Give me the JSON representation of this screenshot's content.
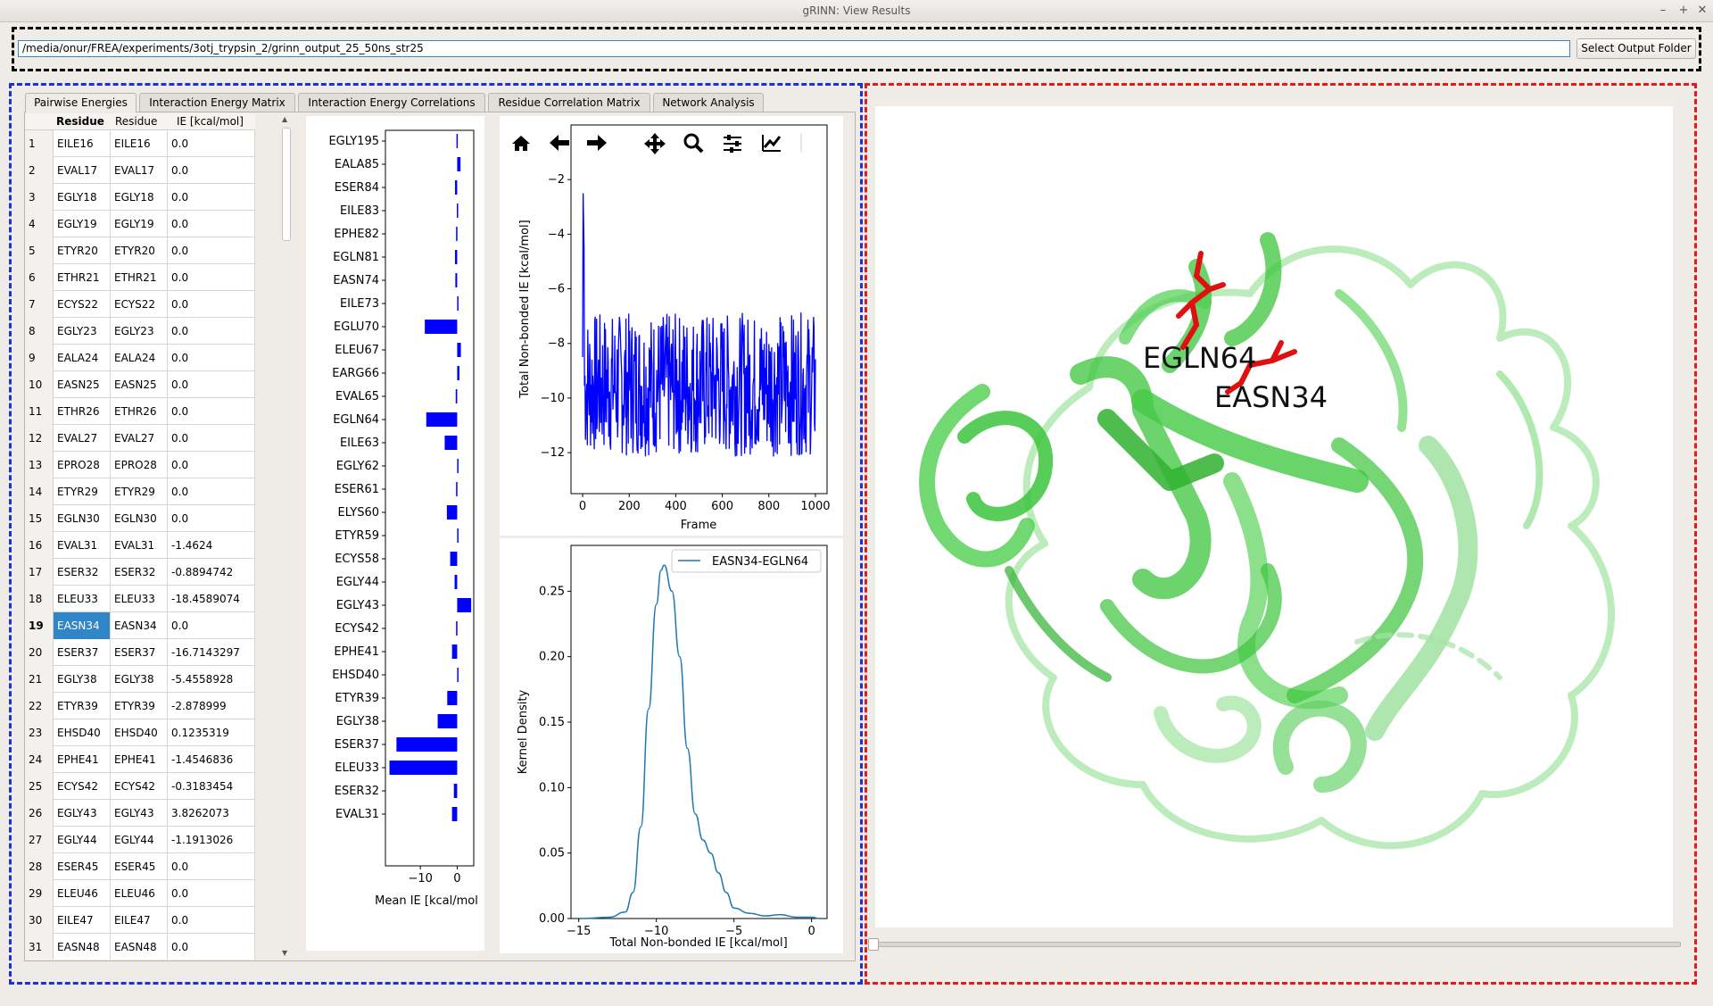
{
  "window": {
    "title": "gRINN: View Results"
  },
  "folder": {
    "path": "/media/onur/FREA/experiments/3otj_trypsin_2/grinn_output_25_50ns_str25",
    "button_label": "Select Output Folder"
  },
  "tabs": [
    {
      "label": "Pairwise Energies"
    },
    {
      "label": "Interaction Energy Matrix"
    },
    {
      "label": "Interaction Energy Correlations"
    },
    {
      "label": "Residue Correlation Matrix"
    },
    {
      "label": "Network Analysis"
    }
  ],
  "table": {
    "headers": [
      "Residue",
      "Residue",
      "IE [kcal/mol]"
    ],
    "selected_row": 19,
    "rows": [
      {
        "n": "1",
        "a": "EILE16",
        "b": "EILE16",
        "ie": "0.0"
      },
      {
        "n": "2",
        "a": "EVAL17",
        "b": "EVAL17",
        "ie": "0.0"
      },
      {
        "n": "3",
        "a": "EGLY18",
        "b": "EGLY18",
        "ie": "0.0"
      },
      {
        "n": "4",
        "a": "EGLY19",
        "b": "EGLY19",
        "ie": "0.0"
      },
      {
        "n": "5",
        "a": "ETYR20",
        "b": "ETYR20",
        "ie": "0.0"
      },
      {
        "n": "6",
        "a": "ETHR21",
        "b": "ETHR21",
        "ie": "0.0"
      },
      {
        "n": "7",
        "a": "ECYS22",
        "b": "ECYS22",
        "ie": "0.0"
      },
      {
        "n": "8",
        "a": "EGLY23",
        "b": "EGLY23",
        "ie": "0.0"
      },
      {
        "n": "9",
        "a": "EALA24",
        "b": "EALA24",
        "ie": "0.0"
      },
      {
        "n": "10",
        "a": "EASN25",
        "b": "EASN25",
        "ie": "0.0"
      },
      {
        "n": "11",
        "a": "ETHR26",
        "b": "ETHR26",
        "ie": "0.0"
      },
      {
        "n": "12",
        "a": "EVAL27",
        "b": "EVAL27",
        "ie": "0.0"
      },
      {
        "n": "13",
        "a": "EPRO28",
        "b": "EPRO28",
        "ie": "0.0"
      },
      {
        "n": "14",
        "a": "ETYR29",
        "b": "ETYR29",
        "ie": "0.0"
      },
      {
        "n": "15",
        "a": "EGLN30",
        "b": "EGLN30",
        "ie": "0.0"
      },
      {
        "n": "16",
        "a": "EVAL31",
        "b": "EVAL31",
        "ie": "-1.4624"
      },
      {
        "n": "17",
        "a": "ESER32",
        "b": "ESER32",
        "ie": "-0.8894742"
      },
      {
        "n": "18",
        "a": "ELEU33",
        "b": "ELEU33",
        "ie": "-18.4589074"
      },
      {
        "n": "19",
        "a": "EASN34",
        "b": "EASN34",
        "ie": "0.0"
      },
      {
        "n": "20",
        "a": "ESER37",
        "b": "ESER37",
        "ie": "-16.7143297"
      },
      {
        "n": "21",
        "a": "EGLY38",
        "b": "EGLY38",
        "ie": "-5.4558928"
      },
      {
        "n": "22",
        "a": "ETYR39",
        "b": "ETYR39",
        "ie": "-2.878999"
      },
      {
        "n": "23",
        "a": "EHSD40",
        "b": "EHSD40",
        "ie": "0.1235319"
      },
      {
        "n": "24",
        "a": "EPHE41",
        "b": "EPHE41",
        "ie": "-1.4546836"
      },
      {
        "n": "25",
        "a": "ECYS42",
        "b": "ECYS42",
        "ie": "-0.3183454"
      },
      {
        "n": "26",
        "a": "EGLY43",
        "b": "EGLY43",
        "ie": "3.8262073"
      },
      {
        "n": "27",
        "a": "EGLY44",
        "b": "EGLY44",
        "ie": "-1.1913026"
      },
      {
        "n": "28",
        "a": "ESER45",
        "b": "ESER45",
        "ie": "0.0"
      },
      {
        "n": "29",
        "a": "ELEU46",
        "b": "ELEU46",
        "ie": "0.0"
      },
      {
        "n": "30",
        "a": "EILE47",
        "b": "EILE47",
        "ie": "0.0"
      },
      {
        "n": "31",
        "a": "EASN48",
        "b": "EASN48",
        "ie": "0.0"
      }
    ]
  },
  "toolbar": {
    "icons": [
      "home-icon",
      "back-arrow-icon",
      "forward-arrow-icon",
      "pan-icon",
      "zoom-icon",
      "configure-subplots-icon",
      "edit-axis-icon"
    ]
  },
  "colors": {
    "bar": "#0000ff",
    "line": "#0000ff",
    "kde": "#1f77b4",
    "protein": "#3cc43c",
    "highlight": "#e01010",
    "selection": "#3186c8"
  },
  "chart_data": [
    {
      "type": "bar",
      "orientation": "horizontal",
      "categories": [
        "EGLY195",
        "EALA85",
        "ESER84",
        "EILE83",
        "EPHE82",
        "EGLN81",
        "EASN74",
        "EILE73",
        "EGLU70",
        "ELEU67",
        "EARG66",
        "EVAL65",
        "EGLN64",
        "EILE63",
        "EGLY62",
        "ESER61",
        "ELYS60",
        "ETYR59",
        "ECYS58",
        "EGLY44",
        "EGLY43",
        "ECYS42",
        "EPHE41",
        "EHSD40",
        "ETYR39",
        "EGLY38",
        "ESER37",
        "ELEU33",
        "ESER32",
        "EVAL31"
      ],
      "values": [
        -0.2,
        0.9,
        -0.6,
        -0.1,
        -0.3,
        -0.6,
        -0.5,
        0.0,
        -8.8,
        1.0,
        0.6,
        -0.4,
        -8.4,
        -3.4,
        0.0,
        -0.3,
        -2.8,
        0.0,
        -1.9,
        -0.7,
        3.8,
        -0.3,
        -1.4,
        0.1,
        -2.7,
        -5.3,
        -16.5,
        -18.4,
        -0.9,
        -1.4
      ],
      "xlabel": "Mean IE [kcal/mol",
      "xticks": [
        -10,
        0
      ],
      "xlim": [
        -19.5,
        4.5
      ]
    },
    {
      "type": "line",
      "series": [
        {
          "name": "EASN34-EGLN64"
        }
      ],
      "xlabel": "Frame",
      "ylabel": "Total Non-bonded IE [kcal/mol]",
      "xlim": [
        -50,
        1050
      ],
      "ylim": [
        -13.5,
        0
      ],
      "xticks": [
        0,
        200,
        400,
        600,
        800,
        1000
      ],
      "yticks": [
        -12,
        -10,
        -8,
        -6,
        -4,
        -2,
        0
      ],
      "mean": -9.5,
      "spread": 1.2
    },
    {
      "type": "line",
      "subtype": "kde",
      "series": [
        {
          "name": "EASN34-EGLN64",
          "x": [
            -14.8,
            -13,
            -12,
            -11.5,
            -11,
            -10.5,
            -10,
            -9.7,
            -9.5,
            -9,
            -8.5,
            -8,
            -7.5,
            -7,
            -6.5,
            -6,
            -5.5,
            -5,
            -4,
            -3,
            -2,
            -1,
            0,
            0.5
          ],
          "y": [
            0,
            0.001,
            0.005,
            0.02,
            0.07,
            0.16,
            0.24,
            0.266,
            0.27,
            0.25,
            0.2,
            0.13,
            0.08,
            0.06,
            0.05,
            0.035,
            0.02,
            0.008,
            0.004,
            0.002,
            0.003,
            0.001,
            0.001,
            0
          ]
        }
      ],
      "xlabel": "Total Non-bonded IE [kcal/mol]",
      "ylabel": "Kernel Density",
      "xlim": [
        -15.5,
        1
      ],
      "ylim": [
        0,
        0.285
      ],
      "xticks": [
        -15,
        -10,
        -5,
        0
      ],
      "yticks": [
        0.0,
        0.05,
        0.1,
        0.15,
        0.2,
        0.25
      ]
    }
  ],
  "molecule": {
    "labels": [
      "EGLN64",
      "EASN34"
    ]
  }
}
